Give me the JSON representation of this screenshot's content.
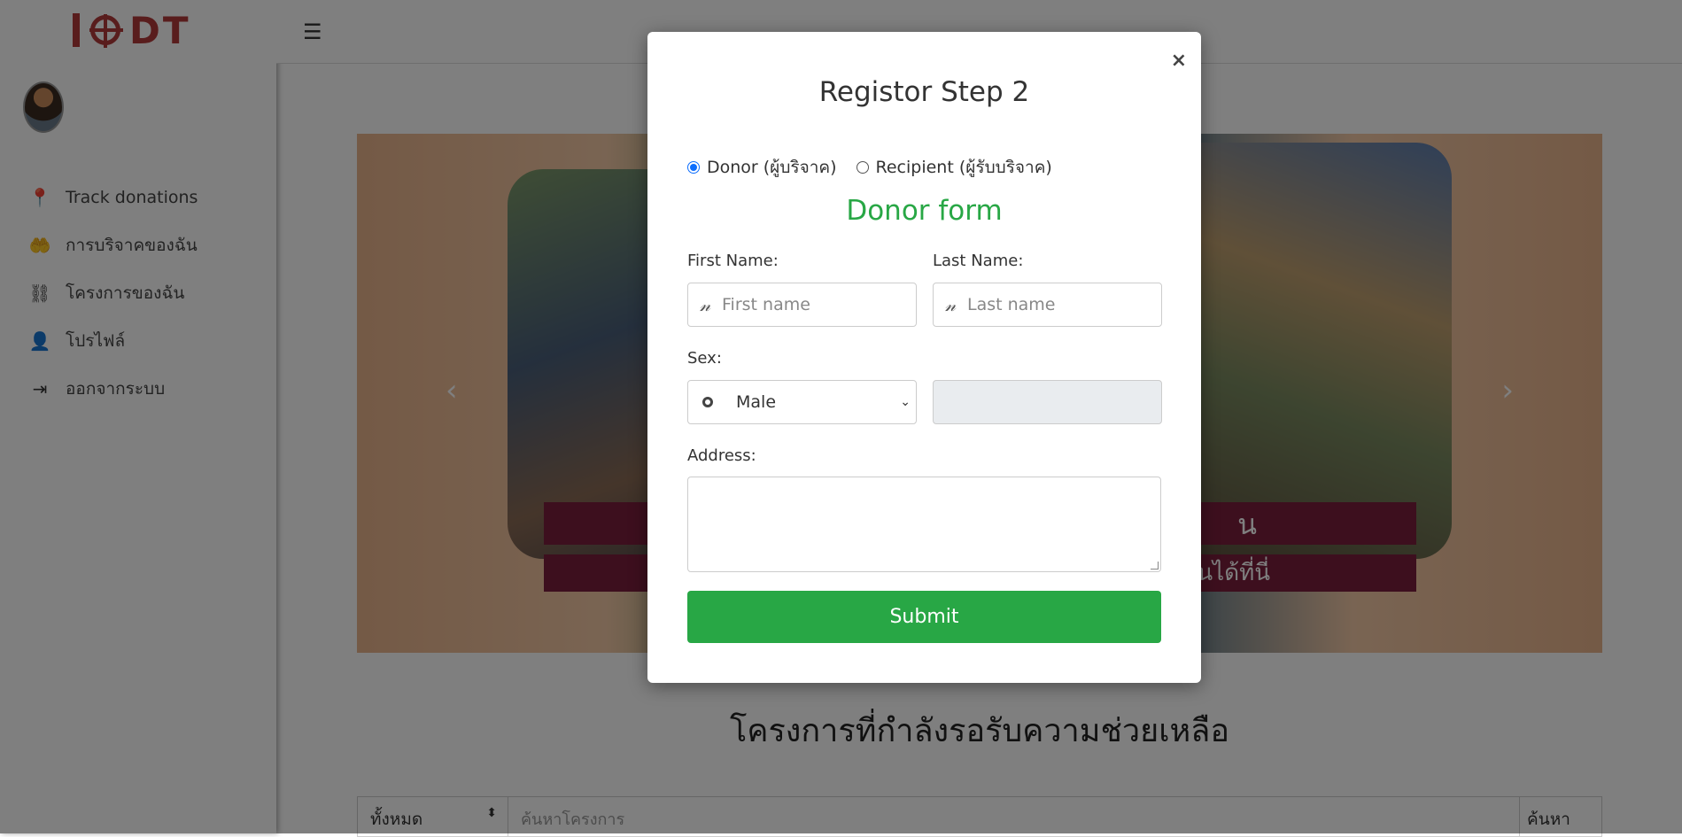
{
  "app": {
    "logo_text": "DT"
  },
  "sidebar": {
    "items": [
      {
        "icon": "map-pin-icon",
        "glyph": "📍",
        "label": "Track donations"
      },
      {
        "icon": "hand-donate-icon",
        "glyph": "🤲",
        "label": "การบริจาคของฉัน"
      },
      {
        "icon": "project-tree-icon",
        "glyph": "⛓",
        "label": "โครงการของฉัน"
      },
      {
        "icon": "user-cog-icon",
        "glyph": "👤",
        "label": "โปรไฟล์"
      },
      {
        "icon": "sign-out-icon",
        "glyph": "⇥",
        "label": "ออกจากระบบ"
      }
    ]
  },
  "topbar": {
    "menu_icon": "☰"
  },
  "carousel": {
    "caption1": "น",
    "caption2": "นได้ที่นี่",
    "prev": "‹",
    "next": "›"
  },
  "main": {
    "section_title": "โครงการที่กำลังรอรับความช่วยเหลือ"
  },
  "search": {
    "filter_value": "ทั้งหมด",
    "placeholder": "ค้นหาโครงการ",
    "button": "ค้นหา"
  },
  "modal": {
    "close": "×",
    "title": "Registor Step 2",
    "roles": [
      {
        "label": "Donor (ผู้บริจาค)",
        "selected": true
      },
      {
        "label": "Recipient (ผู้รับบริจาค)",
        "selected": false
      }
    ],
    "form_title": "Donor form",
    "first_name": {
      "label": "First Name:",
      "placeholder": "First name",
      "icon": "signature-icon"
    },
    "last_name": {
      "label": "Last Name:",
      "placeholder": "Last name",
      "icon": "signature-icon"
    },
    "sex": {
      "label": "Sex:",
      "value": "Male"
    },
    "address": {
      "label": "Address:",
      "value": ""
    },
    "submit": "Submit"
  },
  "colors": {
    "accent_green": "#28a745",
    "logo_red": "#b23a3a",
    "radio_blue": "#0d6efd",
    "caption_bg": "#7a1f3d"
  }
}
